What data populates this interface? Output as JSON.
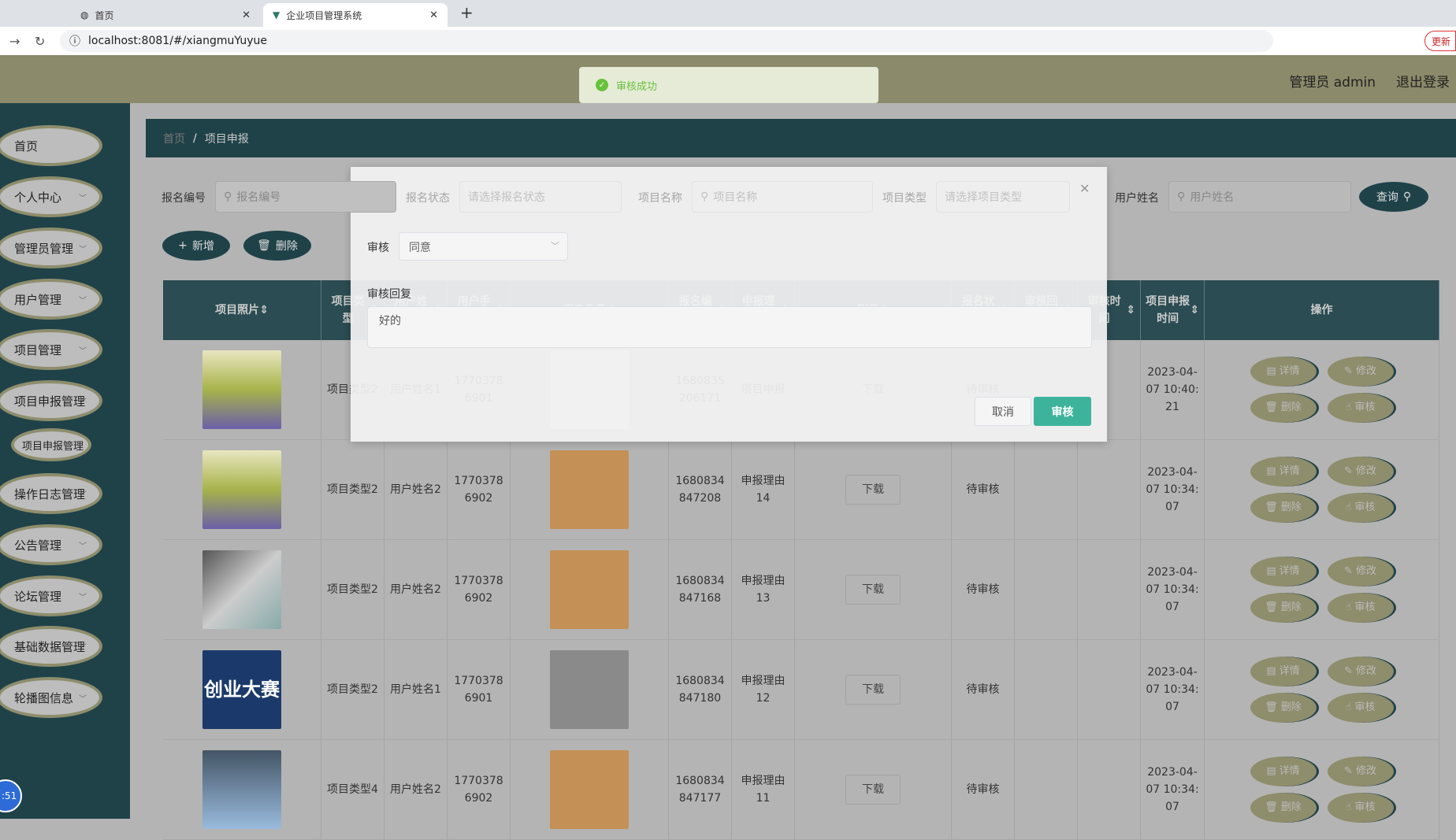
{
  "browser": {
    "tabs": [
      {
        "label": "首页"
      },
      {
        "label": "企业项目管理系统"
      }
    ],
    "url": "localhost:8081/#/xiangmuYuyue",
    "update_label": "更新"
  },
  "header": {
    "title": "企业项目管理系统",
    "user": "管理员 admin",
    "logout": "退出登录"
  },
  "toast": {
    "message": "审核成功",
    "color": "#67c23a"
  },
  "sidebar": {
    "items": [
      {
        "label": "首页"
      },
      {
        "label": "个人中心"
      },
      {
        "label": "管理员管理"
      },
      {
        "label": "用户管理"
      },
      {
        "label": "项目管理"
      },
      {
        "label": "项目申报管理"
      },
      {
        "label": "项目申报管理",
        "sub": true
      },
      {
        "label": "操作日志管理"
      },
      {
        "label": "公告管理"
      },
      {
        "label": "论坛管理"
      },
      {
        "label": "基础数据管理"
      },
      {
        "label": "轮播图信息"
      }
    ]
  },
  "breadcrumb": {
    "home": "首页",
    "current": "项目申报"
  },
  "search": {
    "f1_label": "报名编号",
    "f1_ph": "报名编号",
    "f2_label": "报名状态",
    "f2_ph": "请选择报名状态",
    "f3_label": "项目名称",
    "f3_ph": "项目名称",
    "f4_label": "项目类型",
    "f4_ph": "请选择项目类型",
    "f5_label": "用户姓名",
    "f5_ph": "用户姓名",
    "query": "查询"
  },
  "actions": {
    "add": "新增",
    "delete": "删除"
  },
  "table": {
    "headers": [
      "项目照片",
      "项目类型",
      "用户姓名",
      "用户手机号",
      "用户头像",
      "报名编号",
      "申报理由",
      "附件",
      "报名状态",
      "审核回复",
      "审核时间",
      "项目申报时间",
      "操作"
    ],
    "rows": [
      {
        "type": "项目类型2",
        "user": "用户姓名1",
        "phone": "17703786901",
        "no": "1680835206171",
        "reason": "项目申报",
        "file": "下载",
        "status": "待审核",
        "reply": "",
        "audit_time": "",
        "time": "2023-04-07 10:40:21"
      },
      {
        "type": "项目类型2",
        "user": "用户姓名2",
        "phone": "17703786902",
        "no": "1680834847208",
        "reason": "申报理由14",
        "file": "下载",
        "status": "待审核",
        "reply": "",
        "audit_time": "",
        "time": "2023-04-07 10:34:07"
      },
      {
        "type": "项目类型2",
        "user": "用户姓名2",
        "phone": "17703786902",
        "no": "1680834847168",
        "reason": "申报理由13",
        "file": "下载",
        "status": "待审核",
        "reply": "",
        "audit_time": "",
        "time": "2023-04-07 10:34:07"
      },
      {
        "type": "项目类型2",
        "user": "用户姓名1",
        "phone": "17703786901",
        "no": "1680834847180",
        "reason": "申报理由12",
        "file": "下载",
        "status": "待审核",
        "reply": "",
        "audit_time": "",
        "time": "2023-04-07 10:34:07",
        "img_text": "创业大赛"
      },
      {
        "type": "项目类型4",
        "user": "用户姓名2",
        "phone": "17703786902",
        "no": "1680834847177",
        "reason": "申报理由11",
        "file": "下载",
        "status": "待审核",
        "reply": "",
        "audit_time": "",
        "time": "2023-04-07 10:34:07"
      }
    ],
    "ops": {
      "detail": "详情",
      "edit": "修改",
      "delete": "删除",
      "audit": "审核"
    }
  },
  "dialog": {
    "title": "审核",
    "audit_label": "审核",
    "audit_value": "同意",
    "reply_label": "审核回复",
    "reply_value": "好的",
    "cancel": "取消",
    "confirm": "审核",
    "accent": "#3eb39c"
  },
  "clock": ":51"
}
